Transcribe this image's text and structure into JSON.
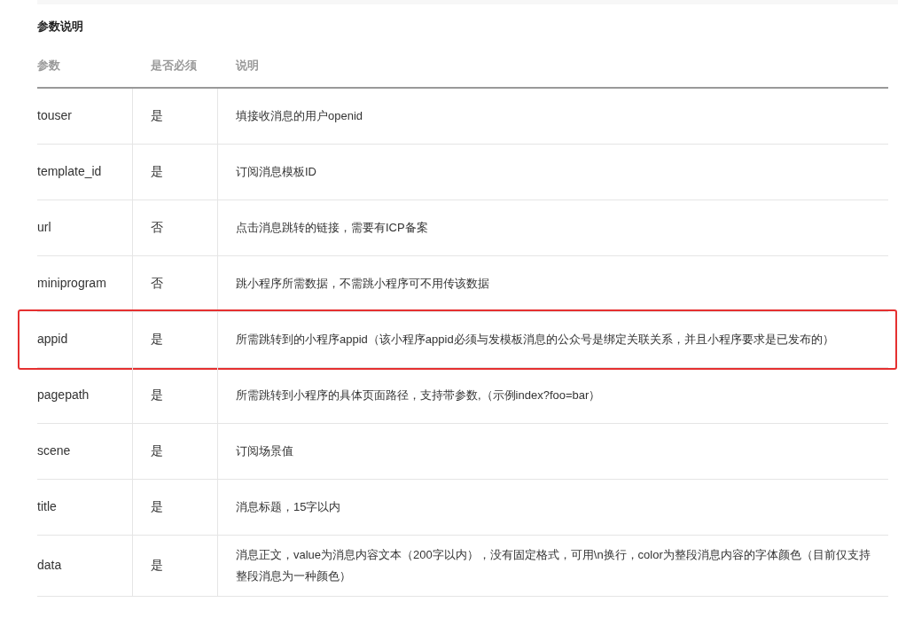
{
  "section_title": "参数说明",
  "table": {
    "columns": [
      "参数",
      "是否必须",
      "说明"
    ],
    "rows": [
      {
        "param": "touser",
        "required": "是",
        "description": "填接收消息的用户openid",
        "highlighted": false
      },
      {
        "param": "template_id",
        "required": "是",
        "description": "订阅消息模板ID",
        "highlighted": false
      },
      {
        "param": "url",
        "required": "否",
        "description": "点击消息跳转的链接，需要有ICP备案",
        "highlighted": false
      },
      {
        "param": "miniprogram",
        "required": "否",
        "description": "跳小程序所需数据，不需跳小程序可不用传该数据",
        "highlighted": false
      },
      {
        "param": "appid",
        "required": "是",
        "description": "所需跳转到的小程序appid（该小程序appid必须与发模板消息的公众号是绑定关联关系，并且小程序要求是已发布的）",
        "highlighted": true
      },
      {
        "param": "pagepath",
        "required": "是",
        "description": "所需跳转到小程序的具体页面路径，支持带参数,（示例index?foo=bar）",
        "highlighted": false
      },
      {
        "param": "scene",
        "required": "是",
        "description": "订阅场景值",
        "highlighted": false
      },
      {
        "param": "title",
        "required": "是",
        "description": "消息标题，15字以内",
        "highlighted": false
      },
      {
        "param": "data",
        "required": "是",
        "description": "消息正文，value为消息内容文本（200字以内），没有固定格式，可用\\n换行，color为整段消息内容的字体颜色（目前仅支持整段消息为一种颜色）",
        "highlighted": false
      }
    ]
  }
}
